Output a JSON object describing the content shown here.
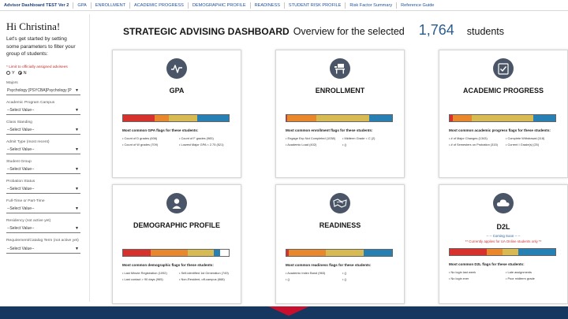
{
  "tabs": [
    {
      "label": "Advisor Dashboard TEST Ver 2",
      "active": true
    },
    {
      "label": "GPA"
    },
    {
      "label": "ENROLLMENT"
    },
    {
      "label": "ACADEMIC PROGRESS"
    },
    {
      "label": "DEMOGRAPHIC PROFILE"
    },
    {
      "label": "READINESS"
    },
    {
      "label": "STUDENT RISK PROFILE"
    },
    {
      "label": "Risk Factor Summary"
    },
    {
      "label": "Reference Guide"
    }
  ],
  "sidebar": {
    "greeting": "Hi Christina!",
    "intro": "Let's get started by setting some parameters to filter your group of students:",
    "limit_label": "* Limit to officially assigned advisees",
    "yes_label": "Y",
    "no_label": "N",
    "selected": "N",
    "filters": [
      {
        "label": "Majors",
        "value": "Psychology [PSYCBA]Psychology [P"
      },
      {
        "label": "Academic Program Campus",
        "value": "--Select Value--"
      },
      {
        "label": "Class Standing",
        "value": "--Select Value--"
      },
      {
        "label": "Admit Type (most recent)",
        "value": "--Select Value--"
      },
      {
        "label": "Student Group",
        "value": "--Select Value--"
      },
      {
        "label": "Probation Status",
        "value": "--Select Value--"
      },
      {
        "label": "Full-Time or Part-Time",
        "value": "--Select Value--"
      },
      {
        "label": "Residency (not active yet)",
        "value": "--Select Value--"
      },
      {
        "label": "Requirement/Catalog Term (not active yet)",
        "value": "--Select Value--"
      }
    ]
  },
  "header": {
    "title": "STRATEGIC ADVISING DASHBOARD",
    "overview": "Overview for the selected",
    "count": "1,764",
    "students": "students"
  },
  "colors": {
    "red": "#d7312d",
    "orange": "#e8872c",
    "yellow": "#d7bb52",
    "blue": "#2680b3",
    "icon": "#4a5667"
  },
  "cards": [
    {
      "id": "gpa",
      "title": "GPA",
      "icon": "pulse-icon",
      "bar": [
        0.3,
        0.13,
        0.27,
        0.3
      ],
      "flag_heading": "Most common GPA flags for these students:",
      "flags": [
        "Count of D grades (606)",
        "Count of F grades (983)",
        "Count of W grades (709)",
        "Lowest Major GPA < 2.75 (521)"
      ]
    },
    {
      "id": "enrollment",
      "title": "ENROLLMENT",
      "icon": "desk-icon",
      "bar": [
        0.01,
        0.27,
        0.5,
        0.22
      ],
      "flag_heading": "Most common enrollment flags for these students:",
      "flags": [
        "Engage Exp Not Completed (1038)",
        "Midterm Grade < C (2)",
        "Academic Load (402)",
        "()"
      ]
    },
    {
      "id": "academic-progress",
      "title": "ACADEMIC PROGRESS",
      "icon": "checklist-icon",
      "bar": [
        0.03,
        0.18,
        0.58,
        0.21
      ],
      "flag_heading": "Most common academic progress flags for these students:",
      "flags": [
        "# of Major Changes (1343)",
        "Complete Withdrawal (118)",
        "# of Semesters on Probation (315)",
        "Current I Grade(s) (25)"
      ]
    },
    {
      "id": "demographic-profile",
      "title": "DEMOGRAPHIC PROFILE",
      "icon": "person-icon",
      "bar": [
        0.26,
        0.35,
        0.25,
        0.06
      ],
      "flag_heading": "Most common demographic flags for these students:",
      "flags": [
        "Last Minute Registration (1092)",
        "Self-identified 1st Generation (749)",
        "Last contact > 90 days (965)",
        "Non-Resident, off-campus (668)"
      ]
    },
    {
      "id": "readiness",
      "title": "READINESS",
      "icon": "map-icon",
      "bar": [
        0.02,
        0.35,
        0.36,
        0.27
      ],
      "flag_heading": "Most common readiness flags for these students:",
      "flags": [
        "Academic Index Band (963)",
        "()",
        "()",
        "()"
      ]
    },
    {
      "id": "d2l",
      "title": "D2L",
      "icon": "cloud-icon",
      "coming_soon": "-- -- Coming Soon -- --",
      "note": "** Currently applies for UA Online students only **",
      "bar": [
        0.35,
        0.15,
        0.15,
        0.35
      ],
      "flag_heading": "Most common D2L flags for these students:",
      "flags": [
        "No login last week",
        "Late assignments",
        "No login ever",
        "Poor midterm grade"
      ]
    }
  ]
}
